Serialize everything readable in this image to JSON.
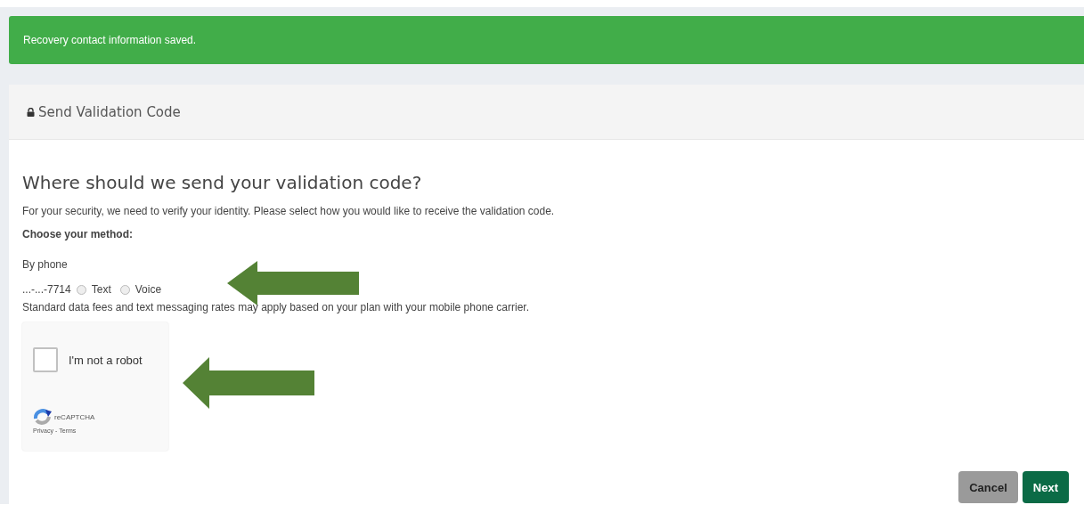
{
  "alert": {
    "message": "Recovery contact information saved."
  },
  "panel": {
    "title": "Send Validation Code"
  },
  "heading": "Where should we send your validation code?",
  "intro": "For your security, we need to verify your identity. Please select how you would like to receive the validation code.",
  "method_label": "Choose your method:",
  "phone": {
    "label": "By phone",
    "number": "...-...-7714",
    "options": [
      {
        "label": "Text",
        "selected": false
      },
      {
        "label": "Voice",
        "selected": false
      }
    ]
  },
  "notice": "Standard data fees and text messaging rates may apply based on your plan with your mobile phone carrier.",
  "captcha": {
    "label": "I'm not a robot",
    "checked": false,
    "brand": "reCAPTCHA",
    "links": [
      "Privacy",
      "Terms"
    ],
    "separator": "-"
  },
  "buttons": [
    {
      "label": "Cancel",
      "kind": "secondary"
    },
    {
      "label": "Next",
      "kind": "primary"
    }
  ]
}
